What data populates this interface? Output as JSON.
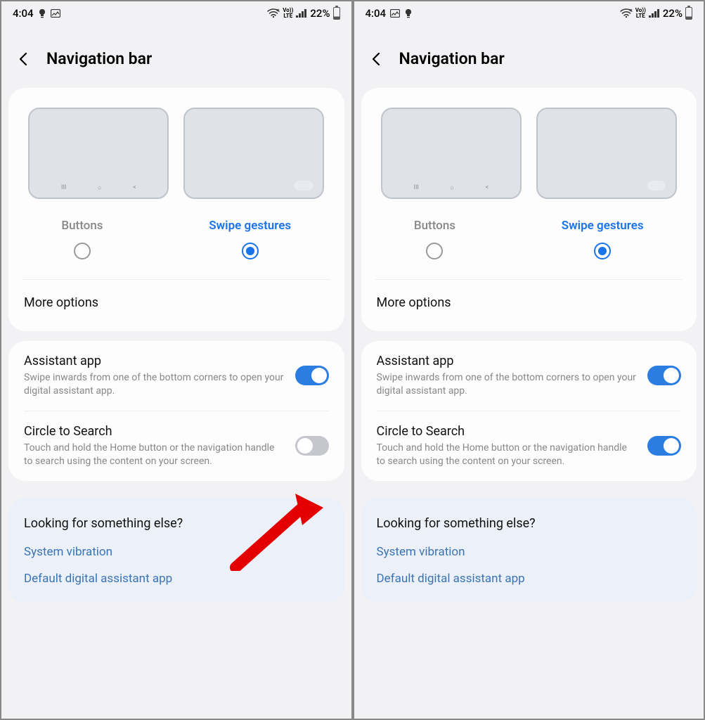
{
  "status": {
    "time": "4:04",
    "battery_pct": "22%",
    "lte_top": "Vo))",
    "lte_bot": "LTE"
  },
  "header": {
    "title": "Navigation bar"
  },
  "nav_type": {
    "buttons_label": "Buttons",
    "swipe_label": "Swipe gestures",
    "selected": "swipe"
  },
  "more_options_label": "More options",
  "toggles": {
    "assistant": {
      "title": "Assistant app",
      "desc": "Swipe inwards from one of the bottom corners to open your digital assistant app."
    },
    "circle": {
      "title": "Circle to Search",
      "desc": "Touch and hold the Home button or the navigation handle to search using the content on your screen."
    }
  },
  "looking": {
    "title": "Looking for something else?",
    "link1": "System vibration",
    "link2": "Default digital assistant app"
  },
  "screens": [
    {
      "assistant_on": true,
      "circle_on": false,
      "show_arrow": true
    },
    {
      "assistant_on": true,
      "circle_on": true,
      "show_arrow": false
    }
  ]
}
